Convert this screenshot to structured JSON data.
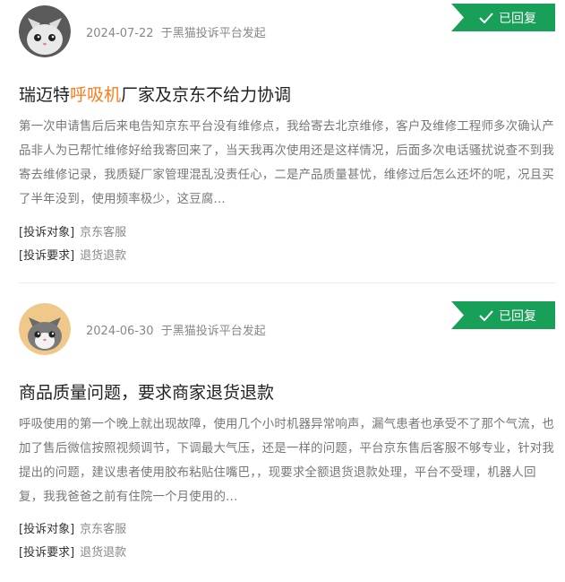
{
  "complaints": [
    {
      "date": "2024-07-22",
      "source": "于黑猫投诉平台发起",
      "status": "已回复",
      "title_before": "瑞迈特",
      "title_highlight": "呼吸机",
      "title_after": "厂家及京东不给力协调",
      "desc": "第一次申请售后后来电告知京东平台没有维修点，我给寄去北京维修，客户及维修工程师多次确认产品非人为已帮忙维修好给我寄回来了，当天我再次使用还是这样情况，后面多次电话骚扰说查不到我寄去维修记录，我质疑厂家管理混乱没责任心，二是产品质量甚忧，维修过后怎么还坏的呢，况且买了半年没到，使用频率极少，这豆腐...",
      "target_label": "[投诉对象]",
      "target_value": "京东客服",
      "demand_label": "[投诉要求]",
      "demand_value": "退货退款"
    },
    {
      "date": "2024-06-30",
      "source": "于黑猫投诉平台发起",
      "status": "已回复",
      "title_before": "商品质量问题，要求商家退货退款",
      "title_highlight": "",
      "title_after": "",
      "desc": "呼吸使用的第一个晚上就出现故障，使用几个小时机器异常响声，漏气患者也承受不了那个气流，也加了售后微信按照视频调节，下调最大气压，还是一样的问题，平台京东售后客服不够专业，针对我提出的问题，建议患者使用胶布粘贴住嘴巴，，现要求全额退货退款处理，平台不受理，机器人回复，我我爸爸之前有住院一个月使用的...",
      "target_label": "[投诉对象]",
      "target_value": "京东客服",
      "demand_label": "[投诉要求]",
      "demand_value": "退货退款"
    }
  ],
  "colors": {
    "accent": "#18a058",
    "highlight": "#ff7a1a"
  }
}
